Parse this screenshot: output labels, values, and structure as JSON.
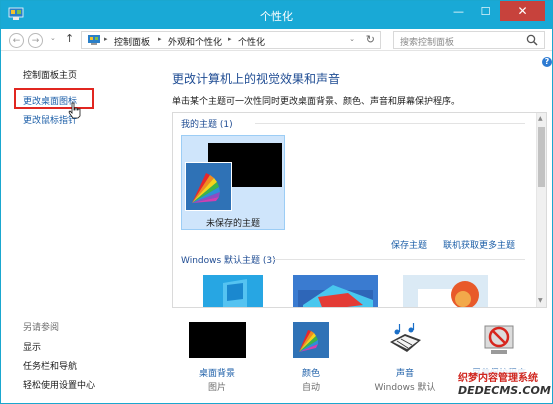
{
  "window": {
    "title": "个性化"
  },
  "title_buttons": {
    "minimize": "—",
    "maximize": "☐",
    "close": "✕"
  },
  "navbar": {
    "back": "←",
    "forward": "→",
    "up": "↑",
    "breadcrumbs": [
      "控制面板",
      "外观和个性化",
      "个性化"
    ],
    "separator": "▸",
    "dropdown": "⌄",
    "refresh": "↻",
    "search_placeholder": "搜索控制面板"
  },
  "help": "?",
  "left_pane": {
    "home_link": "控制面板主页",
    "links": [
      "更改桌面图标",
      "更改鼠标指针"
    ],
    "see_also_title": "另请参阅",
    "see_also": [
      "显示",
      "任务栏和导航",
      "轻松使用设置中心"
    ]
  },
  "main": {
    "title": "更改计算机上的视觉效果和声音",
    "description": "单击某个主题可一次性同时更改桌面背景、颜色、声音和屏幕保护程序。",
    "my_themes_title": "我的主题 (1)",
    "unsaved_theme": "未保存的主题",
    "save_theme": "保存主题",
    "get_more": "联机获取更多主题",
    "default_themes_title": "Windows 默认主题 (3)"
  },
  "tiles": [
    {
      "label": "桌面背景",
      "sub": "图片"
    },
    {
      "label": "颜色",
      "sub": "自动"
    },
    {
      "label": "声音",
      "sub": "Windows 默认"
    },
    {
      "label": "屏幕保护程序",
      "sub": ""
    }
  ],
  "watermark": {
    "line1": "织梦内容管理系统",
    "line2": "DEDECMS.COM"
  },
  "colors": {
    "title_bar": "#19a9d6",
    "close_button": "#c7423c",
    "link": "#1d5fa8",
    "heading": "#1f4c93",
    "selection": "#cfe5fb",
    "highlight_box": "#e12620"
  }
}
